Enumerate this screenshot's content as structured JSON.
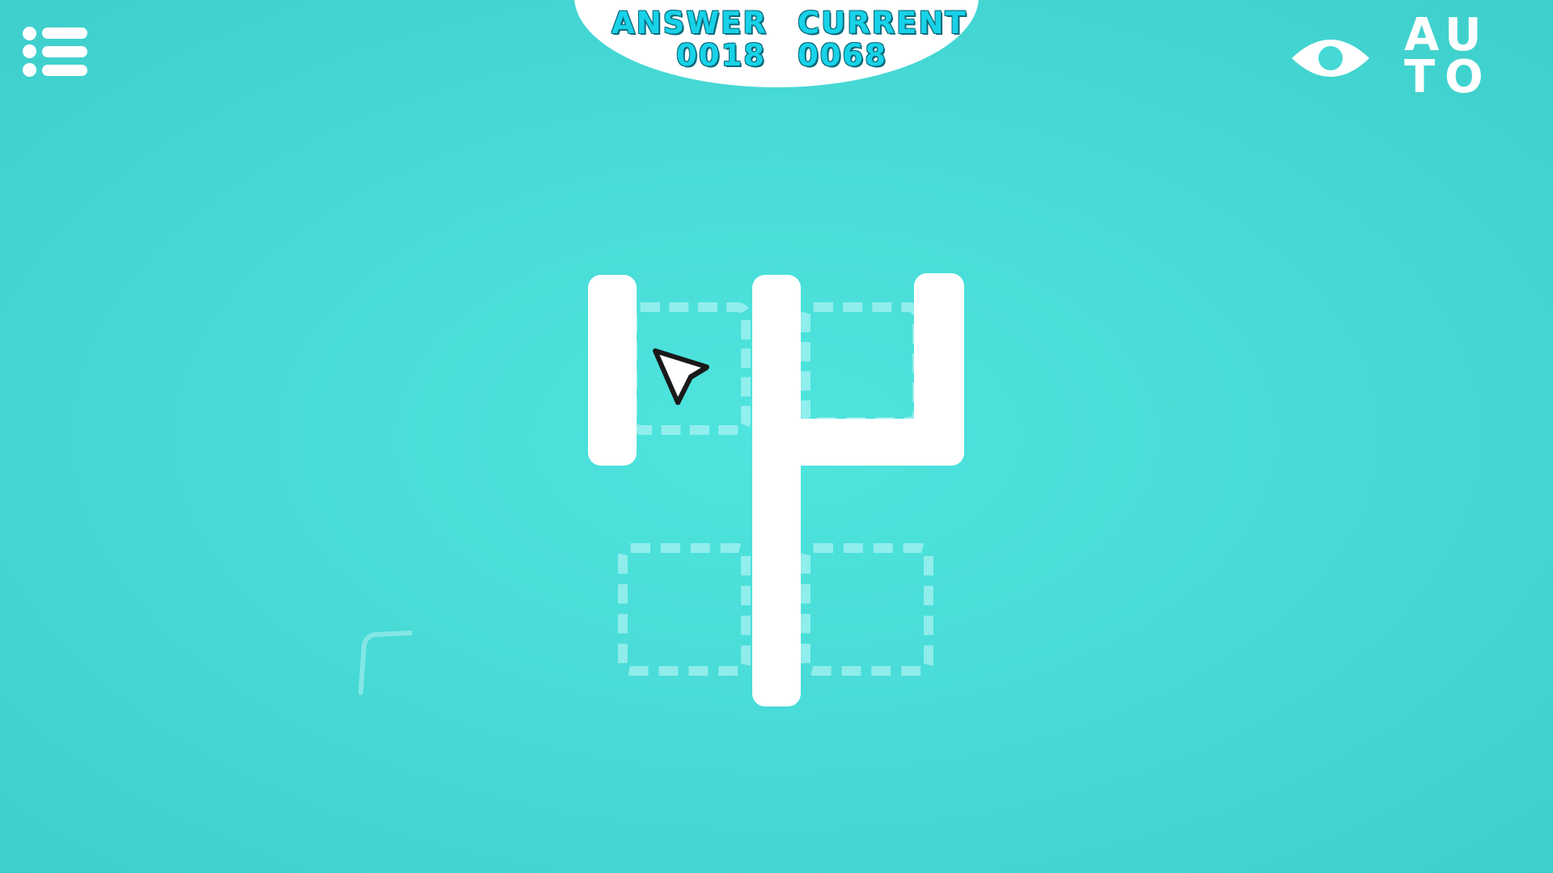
{
  "hud": {
    "answer_label": "ANSWER",
    "answer_value": "0018",
    "current_label": "CURRENT",
    "current_value": "0068",
    "auto_letters": [
      "A",
      "U",
      "T",
      "O"
    ]
  },
  "icons": {
    "menu": "list-icon",
    "eye": "eye-icon",
    "auto": "auto-icon",
    "cursor": "arrow-cursor-icon"
  },
  "colors": {
    "background": "#49dcd8",
    "wall": "#ffffff",
    "target_outline": "#b9f3f3",
    "hud_text": "#18d2e8",
    "hud_text_outline": "#0a6a7a"
  }
}
